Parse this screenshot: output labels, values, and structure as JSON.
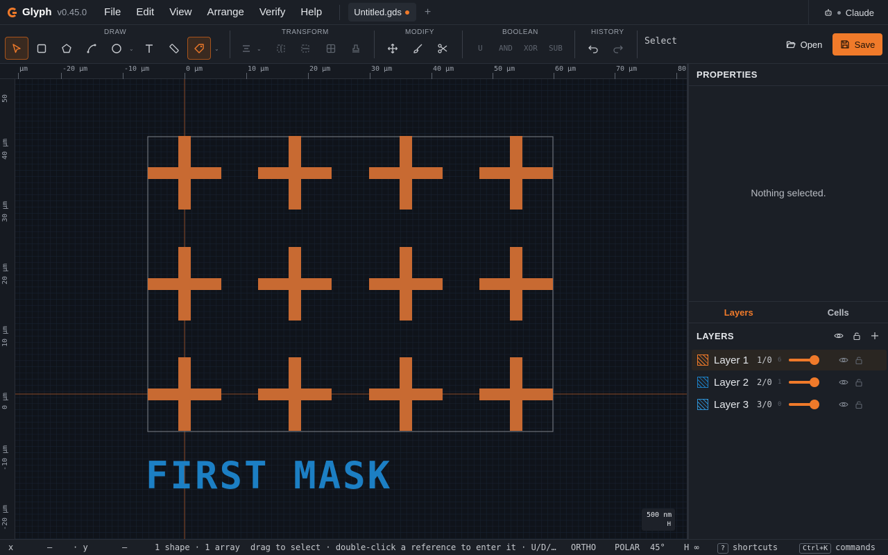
{
  "app": {
    "name": "Glyph",
    "version": "v0.45.0"
  },
  "menus": [
    "File",
    "Edit",
    "View",
    "Arrange",
    "Verify",
    "Help"
  ],
  "document_tab": {
    "title": "Untitled.gds",
    "add_label": "+"
  },
  "user": {
    "name": "Claude"
  },
  "toolbar": {
    "groups": {
      "draw": "DRAW",
      "transform": "TRANSFORM",
      "modify": "MODIFY",
      "boolean": "BOOLEAN",
      "history": "HISTORY"
    },
    "draw_tools": [
      "select-icon",
      "rectangle-icon",
      "polygon-icon",
      "path-icon",
      "circle-icon",
      "text-icon",
      "ruler-icon",
      "label-tag-icon"
    ],
    "transform_tools": [
      "align-icon",
      "mirror-x-icon",
      "mirror-y-icon",
      "array-icon",
      "stamp-icon"
    ],
    "modify_tools": [
      "move-icon",
      "brush-icon",
      "scissors-icon"
    ],
    "boolean_ops": {
      "union": "U",
      "and": "AND",
      "xor": "XOR",
      "sub": "SUB"
    },
    "history_tools": [
      "undo-icon",
      "redo-icon"
    ],
    "mode": "Select",
    "open_label": "Open",
    "save_label": "Save",
    "accent": "#f07a2a"
  },
  "ruler": {
    "top_labels": [
      "µm",
      "-20 µm",
      "-10 µm",
      "0 µm",
      "10 µm",
      "20 µm",
      "30 µm",
      "40 µm",
      "50 µm",
      "60 µm",
      "70 µm",
      "80"
    ],
    "left_labels": [
      "50",
      "40 µm",
      "30 µm",
      "20 µm",
      "10 µm",
      "0 µm",
      "-10 µm",
      "-20 µm"
    ]
  },
  "canvas": {
    "text_label": "FIRST MASK",
    "shape_color": "#c86a32",
    "text_color": "#1c7fc4",
    "scale": {
      "value": "500 nm",
      "h": "H"
    }
  },
  "properties": {
    "title": "PROPERTIES",
    "empty_text": "Nothing selected."
  },
  "panel_tabs": {
    "layers": "Layers",
    "cells": "Cells"
  },
  "layers": {
    "title": "LAYERS",
    "items": [
      {
        "name": "Layer 1",
        "code": "1/0",
        "count": "6",
        "color": "#f07a2a",
        "opacity": 1.0
      },
      {
        "name": "Layer 2",
        "code": "2/0",
        "count": "1",
        "color": "#1c7fc4",
        "opacity": 1.0
      },
      {
        "name": "Layer 3",
        "code": "3/0",
        "count": "0",
        "color": "#2e8fd0",
        "opacity": 1.0
      }
    ]
  },
  "status": {
    "x_label": "x",
    "x_value": "—",
    "y_label": "· y",
    "y_value": "—",
    "summary": "1 shape · 1 array",
    "hint": "drag to select · double-click a reference to enter it · U/D/…",
    "ortho": "ORTHO",
    "polar": "POLAR",
    "angle": "45°",
    "h_inf": "H ∞",
    "shortcuts_key": "?",
    "shortcuts_label": "shortcuts",
    "commands_key": "Ctrl+K",
    "commands_label": "commands"
  }
}
